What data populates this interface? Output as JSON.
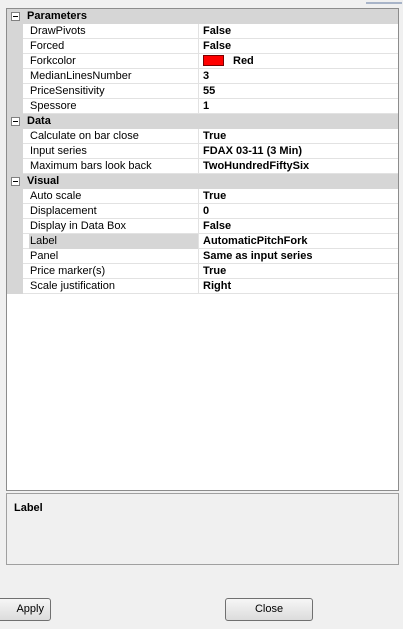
{
  "categories": [
    {
      "label": "Parameters",
      "rows": [
        {
          "name": "DrawPivots",
          "value": "False"
        },
        {
          "name": "Forced",
          "value": "False"
        },
        {
          "name": "Forkcolor",
          "value": "Red",
          "color": "#ff0000"
        },
        {
          "name": "MedianLinesNumber",
          "value": "3"
        },
        {
          "name": "PriceSensitivity",
          "value": "55"
        },
        {
          "name": "Spessore",
          "value": "1"
        }
      ]
    },
    {
      "label": "Data",
      "rows": [
        {
          "name": "Calculate on bar close",
          "value": "True"
        },
        {
          "name": "Input series",
          "value": "FDAX 03-11 (3 Min)"
        },
        {
          "name": "Maximum bars look back",
          "value": "TwoHundredFiftySix"
        }
      ]
    },
    {
      "label": "Visual",
      "rows": [
        {
          "name": "Auto scale",
          "value": "True"
        },
        {
          "name": "Displacement",
          "value": "0"
        },
        {
          "name": "Display in Data Box",
          "value": "False"
        },
        {
          "name": "Label",
          "value": "AutomaticPitchFork",
          "selected": true
        },
        {
          "name": "Panel",
          "value": "Same as input series"
        },
        {
          "name": "Price marker(s)",
          "value": "True"
        },
        {
          "name": "Scale justification",
          "value": "Right"
        }
      ]
    }
  ],
  "description": {
    "title": "Label"
  },
  "buttons": {
    "apply_label": "Apply",
    "close_label": "Close"
  }
}
